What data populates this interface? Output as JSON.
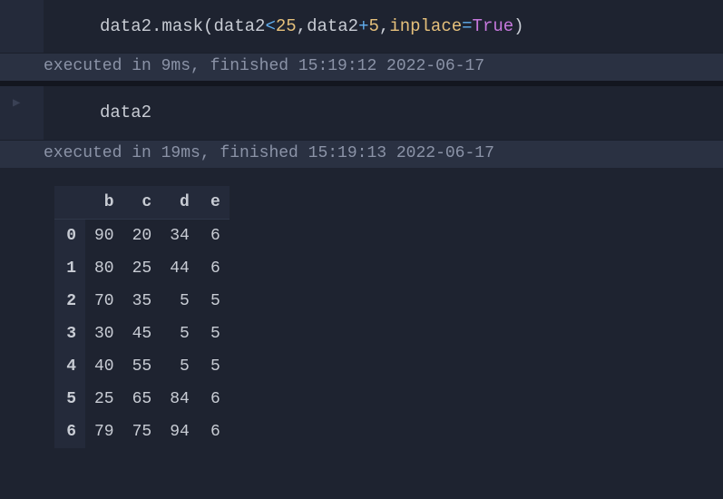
{
  "cell1": {
    "code": {
      "var": "data2",
      "dot1": ".",
      "method": "mask",
      "open": "(",
      "arg_var1": "data2",
      "lt": "<",
      "num25": "25",
      "comma1": ",",
      "arg_var2": "data2",
      "plus": "+",
      "num5": "5",
      "comma2": ",",
      "kw": "inplace",
      "eq": "=",
      "bool": "True",
      "close": ")"
    },
    "status": "executed in 9ms, finished 15:19:12 2022-06-17"
  },
  "cell2": {
    "code": {
      "var": "data2"
    },
    "status": "executed in 19ms, finished 15:19:13 2022-06-17",
    "prompt": "▶"
  },
  "table": {
    "columns": [
      "b",
      "c",
      "d",
      "e"
    ],
    "index": [
      "0",
      "1",
      "2",
      "3",
      "4",
      "5",
      "6"
    ],
    "rows": [
      [
        "90",
        "20",
        "34",
        "6"
      ],
      [
        "80",
        "25",
        "44",
        "6"
      ],
      [
        "70",
        "35",
        "5",
        "5"
      ],
      [
        "30",
        "45",
        "5",
        "5"
      ],
      [
        "40",
        "55",
        "5",
        "5"
      ],
      [
        "25",
        "65",
        "84",
        "6"
      ],
      [
        "79",
        "75",
        "94",
        "6"
      ]
    ]
  }
}
